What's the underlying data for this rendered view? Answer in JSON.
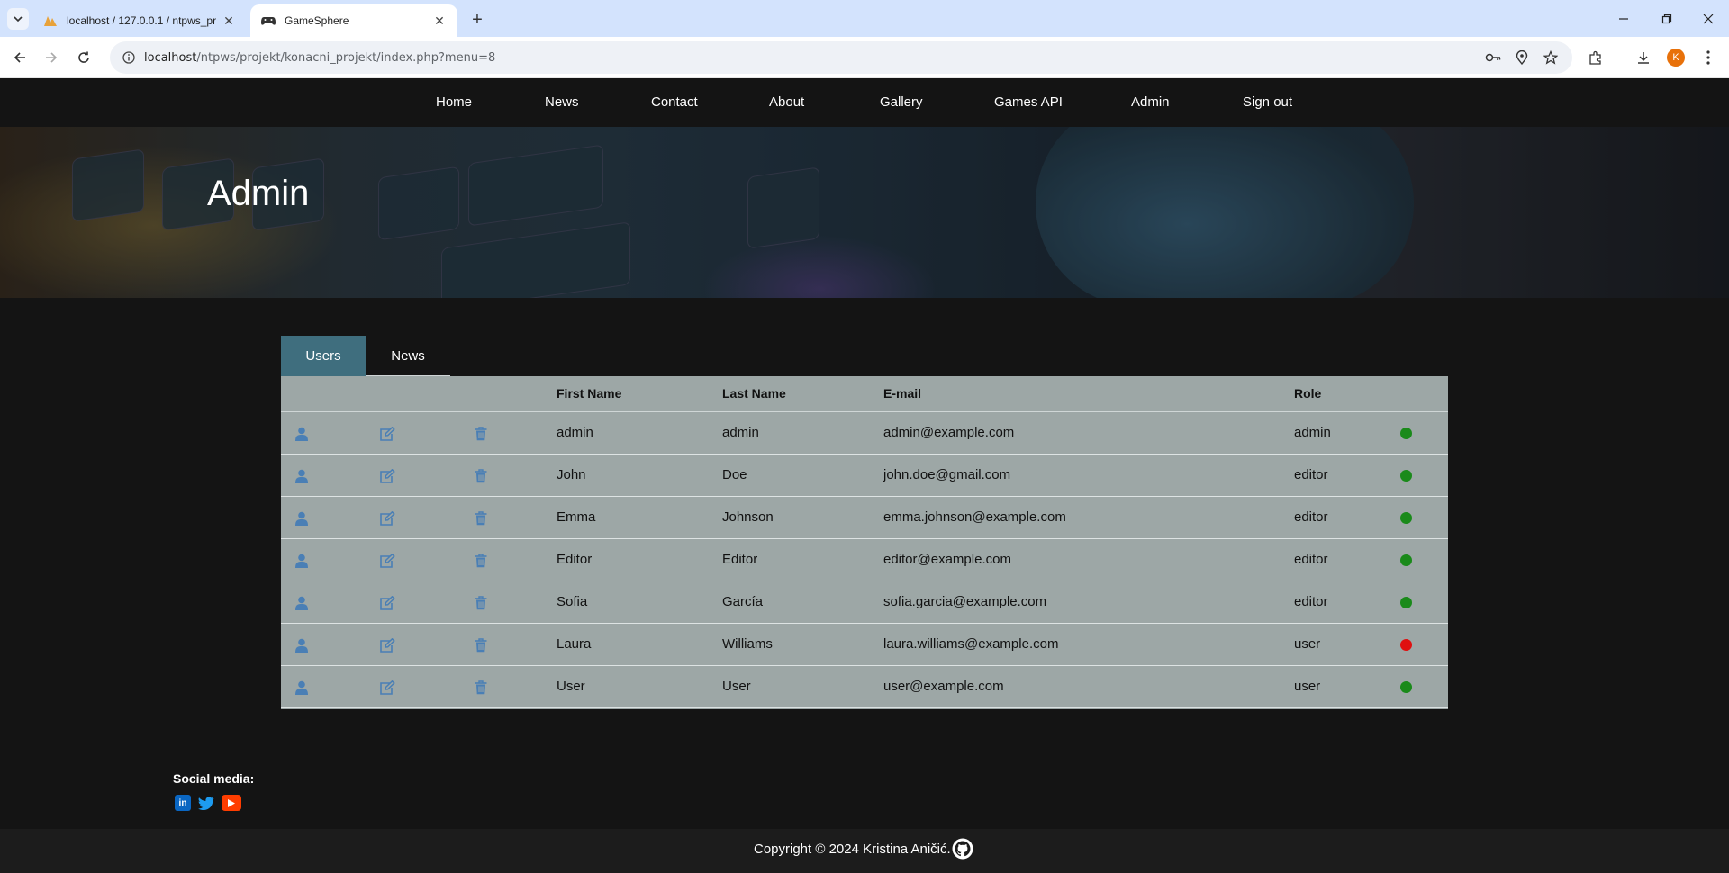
{
  "browser": {
    "tabs": [
      {
        "title": "localhost / 127.0.0.1 / ntpws_pr",
        "active": false
      },
      {
        "title": "GameSphere",
        "active": true
      }
    ],
    "url_host": "localhost",
    "url_path": "/ntpws/projekt/konacni_projekt/index.php?menu=8",
    "profile_initial": "K"
  },
  "nav": {
    "items": [
      "Home",
      "News",
      "Contact",
      "About",
      "Gallery",
      "Games API",
      "Admin",
      "Sign out"
    ]
  },
  "hero": {
    "title": "Admin"
  },
  "admin_tabs": [
    "Users",
    "News"
  ],
  "table": {
    "headers": {
      "first_name": "First Name",
      "last_name": "Last Name",
      "email": "E-mail",
      "role": "Role"
    },
    "rows": [
      {
        "first": "admin",
        "last": "admin",
        "email": "admin@example.com",
        "role": "admin",
        "status_color": "#1a8a1a"
      },
      {
        "first": "John",
        "last": "Doe",
        "email": "john.doe@gmail.com",
        "role": "editor",
        "status_color": "#1a8a1a"
      },
      {
        "first": "Emma",
        "last": "Johnson",
        "email": "emma.johnson@example.com",
        "role": "editor",
        "status_color": "#1a8a1a"
      },
      {
        "first": "Editor",
        "last": "Editor",
        "email": "editor@example.com",
        "role": "editor",
        "status_color": "#1a8a1a"
      },
      {
        "first": "Sofia",
        "last": "García",
        "email": "sofia.garcia@example.com",
        "role": "editor",
        "status_color": "#1a8a1a"
      },
      {
        "first": "Laura",
        "last": "Williams",
        "email": "laura.williams@example.com",
        "role": "user",
        "status_color": "#e01010"
      },
      {
        "first": "User",
        "last": "User",
        "email": "user@example.com",
        "role": "user",
        "status_color": "#1a8a1a"
      }
    ]
  },
  "footer": {
    "social_label": "Social media:",
    "social_icons": [
      "linkedin-icon",
      "twitter-icon",
      "youtube-icon"
    ],
    "copyright": "Copyright © 2024 Kristina Aničić."
  },
  "colors": {
    "accent_tab": "#3f6e7e",
    "icon_blue": "#4a7fb5",
    "panel": "#9da7a6"
  }
}
